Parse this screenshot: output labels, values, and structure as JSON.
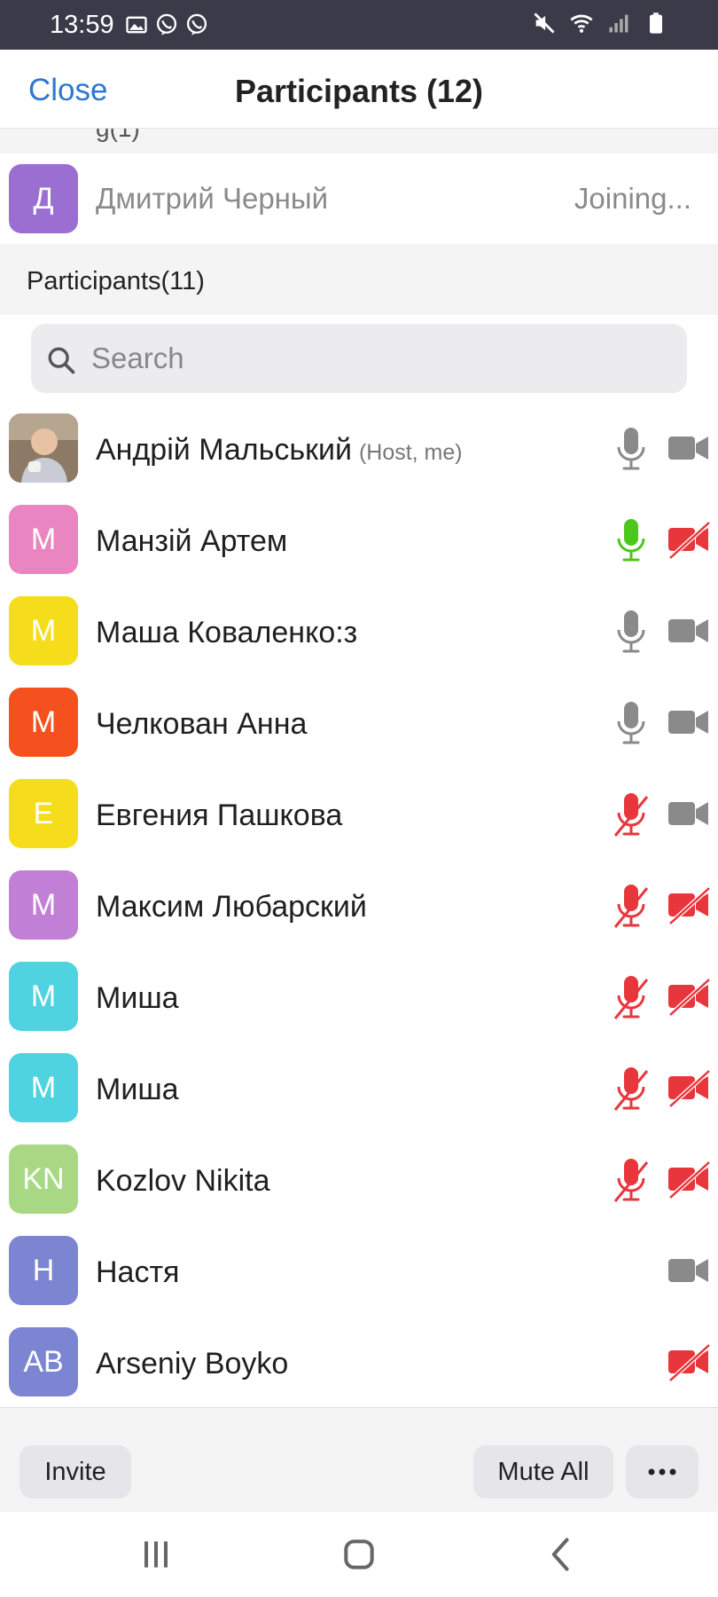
{
  "status_bar": {
    "time": "13:59",
    "left_icons": [
      "image-icon",
      "viber-icon",
      "viber-icon"
    ],
    "right_icons": [
      "mute-icon",
      "wifi-icon",
      "signal-icon",
      "battery-icon"
    ]
  },
  "header": {
    "close_label": "Close",
    "title": "Participants (12)"
  },
  "waiting": {
    "avatar_letter": "Д",
    "avatar_color": "#9a6fd1",
    "name": "Дмитрий Черный",
    "status": "Joining..."
  },
  "section": {
    "title": "Participants(11)"
  },
  "search": {
    "placeholder": "Search"
  },
  "participants": [
    {
      "name": "Андрій Мальський",
      "role": "(Host, me)",
      "initials": "",
      "color": "#7a6655",
      "mic": "off-gray",
      "cam": "on",
      "photo": true
    },
    {
      "name": "Манзій Артем",
      "role": "",
      "initials": "М",
      "color": "#e985c0",
      "mic": "on",
      "cam": "off"
    },
    {
      "name": "Маша Коваленко:з",
      "role": "",
      "initials": "М",
      "color": "#f6dd1c",
      "mic": "off-gray",
      "cam": "on"
    },
    {
      "name": "Челкован Анна",
      "role": "",
      "initials": "М",
      "color": "#f4511e",
      "mic": "off-gray",
      "cam": "on"
    },
    {
      "name": "Евгения Пашкова",
      "role": "",
      "initials": "Е",
      "color": "#f6dd1c",
      "mic": "muted",
      "cam": "on"
    },
    {
      "name": "Максим Любарский",
      "role": "",
      "initials": "М",
      "color": "#c17fd6",
      "mic": "muted",
      "cam": "off"
    },
    {
      "name": "Миша",
      "role": "",
      "initials": "М",
      "color": "#4fd3e0",
      "mic": "muted",
      "cam": "off"
    },
    {
      "name": "Миша",
      "role": "",
      "initials": "М",
      "color": "#4fd3e0",
      "mic": "muted",
      "cam": "off"
    },
    {
      "name": "Kozlov Nikita",
      "role": "",
      "initials": "KN",
      "color": "#a8d884",
      "mic": "muted",
      "cam": "off"
    },
    {
      "name": "Настя",
      "role": "",
      "initials": "Н",
      "color": "#7b85d2",
      "mic": "none",
      "cam": "on"
    },
    {
      "name": "Arseniy Boyko",
      "role": "",
      "initials": "AB",
      "color": "#7b85d2",
      "mic": "none",
      "cam": "off"
    }
  ],
  "bottom_bar": {
    "invite_label": "Invite",
    "mute_all_label": "Mute All",
    "more_label": "•••"
  },
  "colors": {
    "accent": "#2e77d0",
    "mic_active": "#4cc71a",
    "muted_red": "#e8373c",
    "icon_gray": "#8a8a8a"
  }
}
